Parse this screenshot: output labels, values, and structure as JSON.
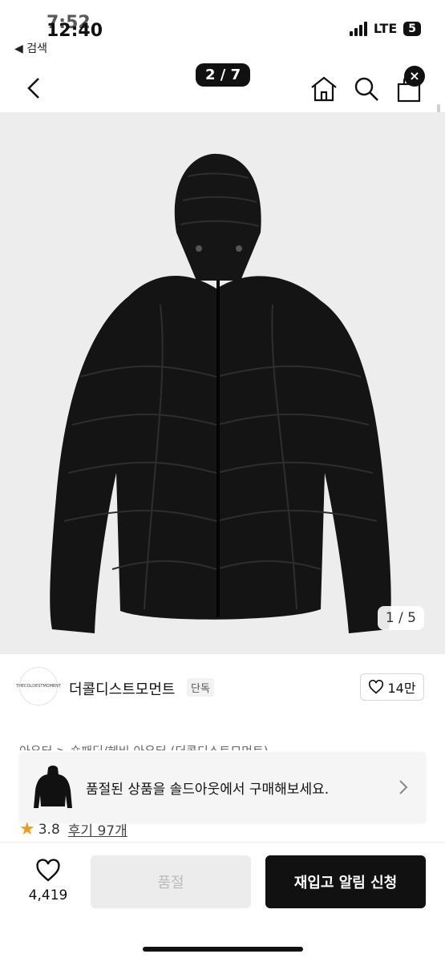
{
  "status_bar": {
    "time_back": "7:52",
    "time_front": "12:40",
    "back_app": "◀ 검색",
    "network": "LTE",
    "battery": "5"
  },
  "header": {
    "image_counter": "2 / 7",
    "bag_badge": "×"
  },
  "hero": {
    "image_counter": "1 / 5"
  },
  "brand": {
    "name": "더콜디스트모먼트",
    "tag": "단독",
    "likes": "14만",
    "logo_text": "THECOLDESTMOMENT"
  },
  "breadcrumb": "아우터 > 숏패딩/헤비 아우터 (더콜디스트모먼트)",
  "banner": {
    "text": "품절된 상품을 솔드아웃에서 구매해보세요."
  },
  "rating": {
    "score": "3.8",
    "reviews": "후기 97개"
  },
  "bottom_bar": {
    "wish_count": "4,419",
    "soldout_label": "품절",
    "restock_label": "재입고 알림 신청"
  }
}
